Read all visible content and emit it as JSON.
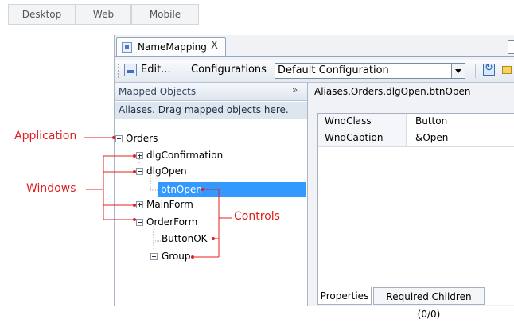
{
  "platform_tabs": [
    "Desktop",
    "Web",
    "Mobile"
  ],
  "document_tab": {
    "title": "NameMapping",
    "close": "X"
  },
  "toolbar": {
    "edit_label": "Edit...",
    "configurations_label": "Configurations",
    "configuration_value": "Default Configuration"
  },
  "left_panel": {
    "header": "Mapped Objects",
    "collapse_glyph": "»",
    "hint": "Aliases. Drag mapped objects here.",
    "tree": [
      {
        "label": "Orders",
        "expander": "minus"
      },
      {
        "label": "dlgConfirmation",
        "expander": "plus"
      },
      {
        "label": "dlgOpen",
        "expander": "minus"
      },
      {
        "label": "btnOpen",
        "expander": "none",
        "selected": true
      },
      {
        "label": "MainForm",
        "expander": "plus"
      },
      {
        "label": "OrderForm",
        "expander": "minus"
      },
      {
        "label": "ButtonOK",
        "expander": "none"
      },
      {
        "label": "Group",
        "expander": "plus"
      }
    ]
  },
  "right_panel": {
    "path": "Aliases.Orders.dlgOpen.btnOpen",
    "properties": [
      {
        "name": "WndClass",
        "value": "Button"
      },
      {
        "name": "WndCaption",
        "value": "&Open"
      }
    ],
    "bottom_tabs": [
      "Properties",
      "Required Children (0/0)"
    ]
  },
  "callouts": {
    "application": "Application",
    "windows": "Windows",
    "controls": "Controls",
    "color": "#e02020"
  }
}
